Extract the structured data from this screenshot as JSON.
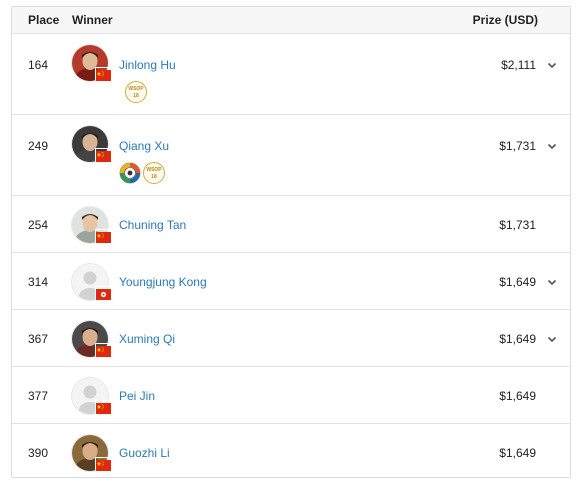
{
  "header": {
    "place": "Place",
    "winner": "Winner",
    "prize": "Prize (USD)"
  },
  "rows": [
    {
      "place": "164",
      "name": "Jinlong Hu",
      "prize": "$2,111",
      "flag": "china",
      "photo": true,
      "badges": [
        "wsop"
      ],
      "expandable": true
    },
    {
      "place": "249",
      "name": "Qiang Xu",
      "prize": "$1,731",
      "flag": "china",
      "photo": true,
      "badges": [
        "chip",
        "wsop"
      ],
      "expandable": true
    },
    {
      "place": "254",
      "name": "Chuning Tan",
      "prize": "$1,731",
      "flag": "china",
      "photo": true,
      "badges": [],
      "expandable": false
    },
    {
      "place": "314",
      "name": "Youngjung Kong",
      "prize": "$1,649",
      "flag": "hong-kong",
      "photo": false,
      "badges": [],
      "expandable": true
    },
    {
      "place": "367",
      "name": "Xuming Qi",
      "prize": "$1,649",
      "flag": "china",
      "photo": true,
      "badges": [],
      "expandable": true
    },
    {
      "place": "377",
      "name": "Pei Jin",
      "prize": "$1,649",
      "flag": "china",
      "photo": false,
      "badges": [],
      "expandable": false
    },
    {
      "place": "390",
      "name": "Guozhi Li",
      "prize": "$1,649",
      "flag": "china",
      "photo": true,
      "badges": [],
      "expandable": false
    }
  ],
  "badge_text": {
    "wsop_top": "WSOP",
    "wsop_bottom": "18"
  },
  "colors": {
    "link": "#2a7ab8",
    "gold": "#d7aa3a",
    "china_red": "#de2910",
    "china_star": "#ffde00"
  }
}
